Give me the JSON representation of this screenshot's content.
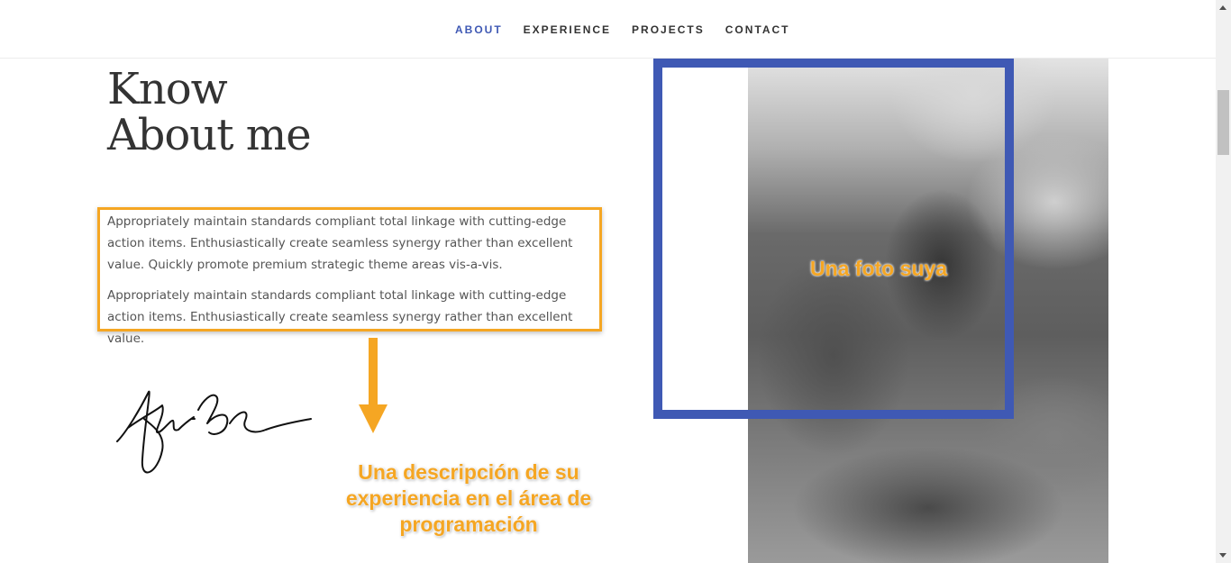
{
  "nav": {
    "items": [
      {
        "label": "ABOUT",
        "active": true
      },
      {
        "label": "EXPERIENCE",
        "active": false
      },
      {
        "label": "PROJECTS",
        "active": false
      },
      {
        "label": "CONTACT",
        "active": false
      }
    ],
    "active_color": "#3f59b4"
  },
  "about": {
    "title_line1": "Know",
    "title_line2": "About me",
    "paragraph1": "Appropriately maintain standards compliant total linkage with cutting-edge action items. Enthusiastically create seamless synergy rather than excellent value. Quickly promote premium strategic theme areas vis-a-vis.",
    "paragraph2": "Appropriately maintain standards compliant total linkage with cutting-edge action items. Enthusiastically create seamless synergy rather than excellent value."
  },
  "annotations": {
    "description_note": "Una descripción de su experiencia en el área de programación",
    "photo_note": "Una foto suya",
    "highlight_color": "#f5a623"
  },
  "colors": {
    "frame": "#3f59b4",
    "text": "#333333"
  }
}
